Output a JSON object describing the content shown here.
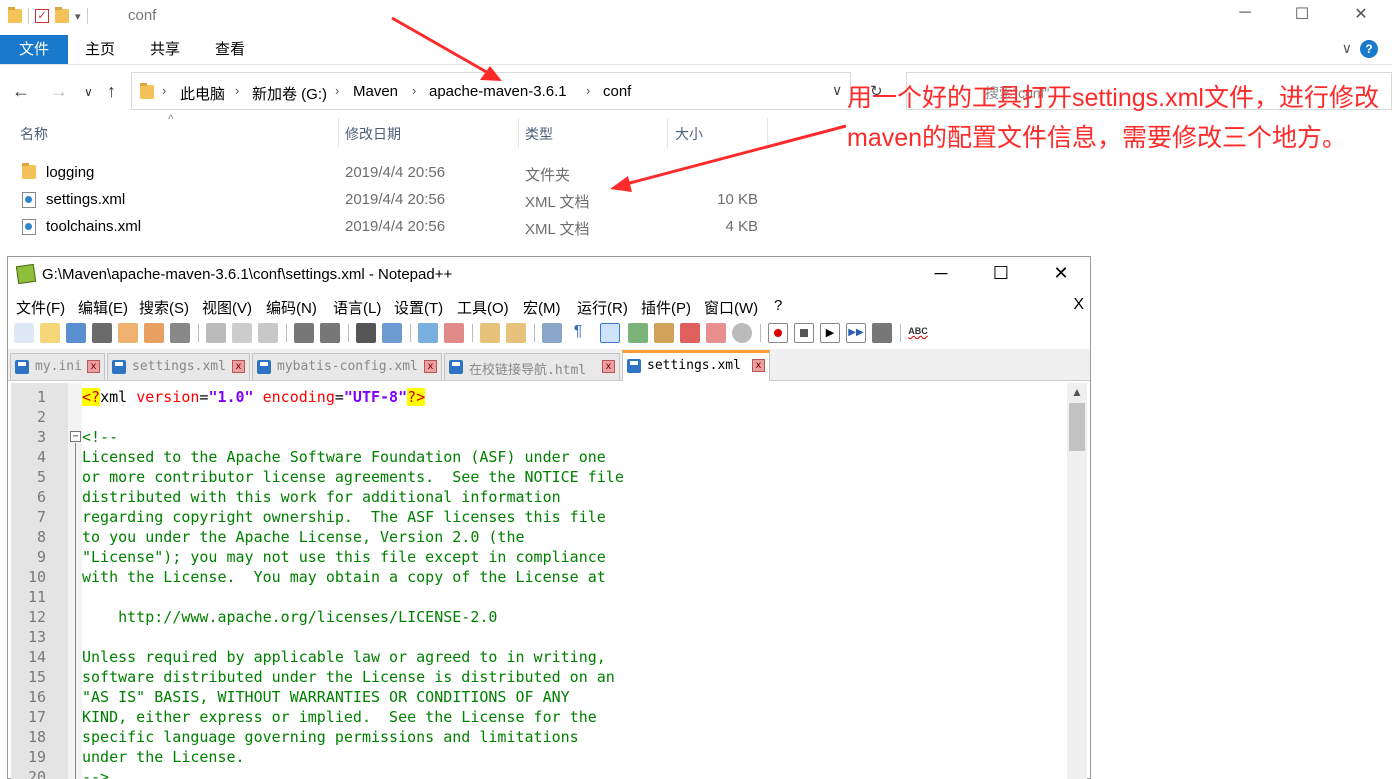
{
  "explorer": {
    "title": "conf",
    "ribbon_tabs": [
      "文件",
      "主页",
      "共享",
      "查看"
    ],
    "breadcrumb": [
      "此电脑",
      "新加卷 (G:)",
      "Maven",
      "apache-maven-3.6.1",
      "conf"
    ],
    "search_placeholder": "搜索\"conf\"",
    "columns": [
      "名称",
      "修改日期",
      "类型",
      "大小"
    ],
    "files": [
      {
        "name": "logging",
        "date": "2019/4/4 20:56",
        "type": "文件夹",
        "size": "",
        "icon": "folder-icon"
      },
      {
        "name": "settings.xml",
        "date": "2019/4/4 20:56",
        "type": "XML 文档",
        "size": "10 KB",
        "icon": "xml-file-icon"
      },
      {
        "name": "toolchains.xml",
        "date": "2019/4/4 20:56",
        "type": "XML 文档",
        "size": "4 KB",
        "icon": "xml-file-icon"
      }
    ]
  },
  "annotation": {
    "text": "用一个好的工具打开settings.xml文件，进行修改maven的配置文件信息，需要修改三个地方。",
    "color": "#ff2a2a"
  },
  "npp": {
    "title": "G:\\Maven\\apache-maven-3.6.1\\conf\\settings.xml - Notepad++",
    "menus": [
      "文件(F)",
      "编辑(E)",
      "搜索(S)",
      "视图(V)",
      "编码(N)",
      "语言(L)",
      "设置(T)",
      "工具(O)",
      "宏(M)",
      "运行(R)",
      "插件(P)",
      "窗口(W)",
      "?"
    ],
    "menu_close": "X",
    "tabs": [
      "my.ini",
      "settings.xml",
      "mybatis-config.xml",
      "在校链接导航.html",
      "settings.xml"
    ],
    "active_tab": 4,
    "accent": "#fa9c3a",
    "lines": [
      {
        "n": "1",
        "t": ""
      },
      {
        "n": "2",
        "t": ""
      },
      {
        "n": "3",
        "t": "<!--"
      },
      {
        "n": "4",
        "t": "Licensed to the Apache Software Foundation (ASF) under one"
      },
      {
        "n": "5",
        "t": "or more contributor license agreements.  See the NOTICE file"
      },
      {
        "n": "6",
        "t": "distributed with this work for additional information"
      },
      {
        "n": "7",
        "t": "regarding copyright ownership.  The ASF licenses this file"
      },
      {
        "n": "8",
        "t": "to you under the Apache License, Version 2.0 (the"
      },
      {
        "n": "9",
        "t": "\"License\"); you may not use this file except in compliance"
      },
      {
        "n": "10",
        "t": "with the License.  You may obtain a copy of the License at"
      },
      {
        "n": "11",
        "t": ""
      },
      {
        "n": "12",
        "t": "    http://www.apache.org/licenses/LICENSE-2.0"
      },
      {
        "n": "13",
        "t": ""
      },
      {
        "n": "14",
        "t": "Unless required by applicable law or agreed to in writing,"
      },
      {
        "n": "15",
        "t": "software distributed under the License is distributed on an"
      },
      {
        "n": "16",
        "t": "\"AS IS\" BASIS, WITHOUT WARRANTIES OR CONDITIONS OF ANY"
      },
      {
        "n": "17",
        "t": "KIND, either express or implied.  See the License for the"
      },
      {
        "n": "18",
        "t": "specific language governing permissions and limitations"
      },
      {
        "n": "19",
        "t": "under the License."
      },
      {
        "n": "20",
        "t": "-->"
      }
    ],
    "decl": {
      "open": "<?",
      "name": "xml",
      "attr1": "version",
      "val1": "\"1.0\"",
      "attr2": "encoding",
      "val2": "\"UTF-8\"",
      "close": "?>"
    }
  }
}
